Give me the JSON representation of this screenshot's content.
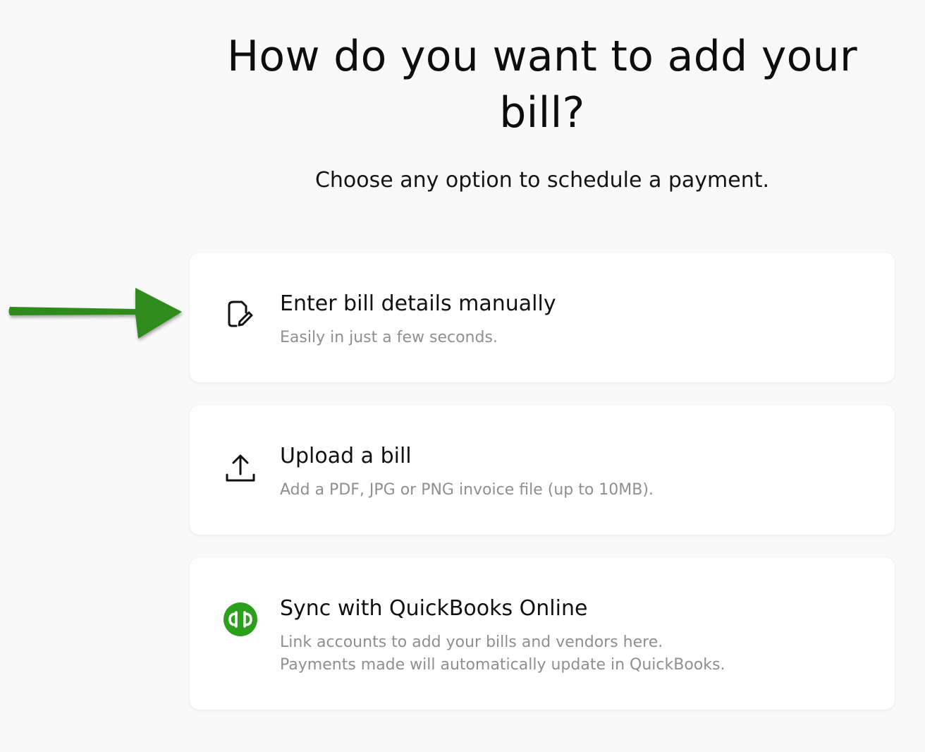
{
  "header": {
    "title": "How do you want to add your bill?",
    "subtitle": "Choose any option to schedule a payment."
  },
  "annotation": {
    "arrow_color": "#2e8b1e",
    "icon": "arrow-right-icon"
  },
  "options": [
    {
      "icon": "document-edit-icon",
      "title": "Enter bill details manually",
      "description": "Easily in just a few seconds."
    },
    {
      "icon": "upload-icon",
      "title": "Upload a bill",
      "description": "Add a PDF, JPG or PNG invoice file (up to 10MB)."
    },
    {
      "icon": "quickbooks-logo-icon",
      "title": "Sync with QuickBooks Online",
      "description_lines": [
        "Link accounts to add your bills and vendors here.",
        "Payments made will automatically update in QuickBooks."
      ]
    }
  ],
  "colors": {
    "background": "#f9f9f9",
    "card": "#ffffff",
    "description_text": "#8f8f8f",
    "quickbooks_green": "#2ca01c"
  }
}
